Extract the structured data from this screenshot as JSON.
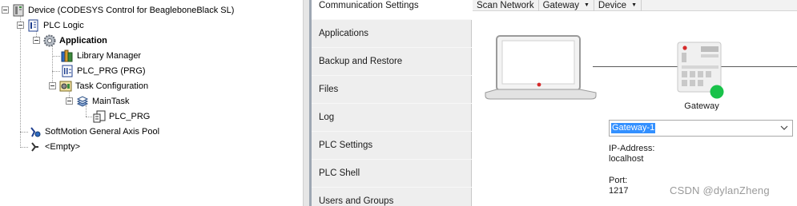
{
  "tree": {
    "device_label": "Device (CODESYS Control for BeagleboneBlack SL)",
    "plc_logic_label": "PLC Logic",
    "application_label": "Application",
    "library_manager_label": "Library Manager",
    "plc_prg_pou_label": "PLC_PRG (PRG)",
    "task_configuration_label": "Task Configuration",
    "main_task_label": "MainTask",
    "plc_prg_call_label": "PLC_PRG",
    "softmotion_pool_label": "SoftMotion General Axis Pool",
    "empty_label": "<Empty>"
  },
  "tabs": [
    {
      "label": "Communication Settings",
      "active": true
    },
    {
      "label": "Applications",
      "active": false
    },
    {
      "label": "Backup and Restore",
      "active": false
    },
    {
      "label": "Files",
      "active": false
    },
    {
      "label": "Log",
      "active": false
    },
    {
      "label": "PLC Settings",
      "active": false
    },
    {
      "label": "PLC Shell",
      "active": false
    },
    {
      "label": "Users and Groups",
      "active": false
    }
  ],
  "toolbar": {
    "scan_network": "Scan Network",
    "gateway": "Gateway",
    "device": "Device",
    "caret": "▼"
  },
  "gateway": {
    "label": "Gateway",
    "selected": "Gateway-1",
    "ip_label": "IP-Address:",
    "ip_value": "localhost",
    "port_label": "Port:",
    "port_value": "1217",
    "status_color": "#19c24a"
  },
  "watermark": "CSDN @dylanZheng",
  "icons": {
    "device": "device-icon",
    "plc_logic": "plc-logic-icon",
    "application": "gear-icon",
    "library_manager": "books-icon",
    "pou": "pou-icon",
    "task_configuration": "task-config-icon",
    "task": "task-stack-icon",
    "program_call": "program-call-icon",
    "softmotion": "axis-pool-icon",
    "empty": "axis-empty-icon",
    "laptop": "laptop-icon",
    "gateway": "gateway-device-icon",
    "dropdown": "chevron-down-icon"
  }
}
